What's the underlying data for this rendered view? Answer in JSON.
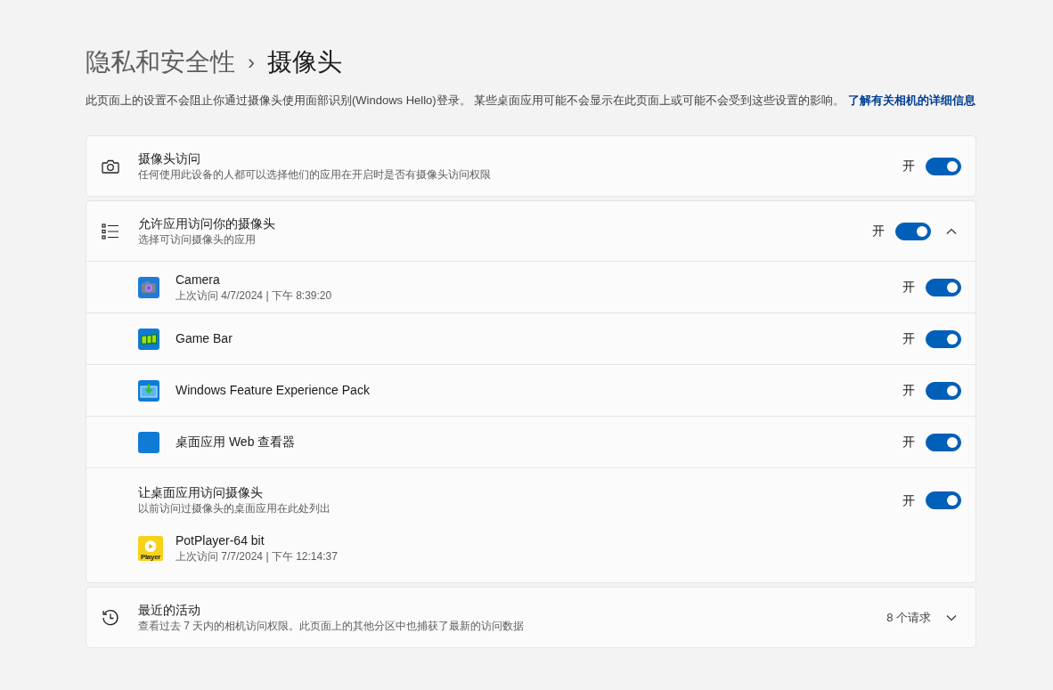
{
  "breadcrumb": {
    "parent": "隐私和安全性",
    "separator": "›",
    "current": "摄像头"
  },
  "description": {
    "text": "此页面上的设置不会阻止你通过摄像头使用面部识别(Windows Hello)登录。 某些桌面应用可能不会显示在此页面上或可能不会受到这些设置的影响。",
    "link": "了解有关相机的详细信息"
  },
  "camera_access": {
    "title": "摄像头访问",
    "subtitle": "任何使用此设备的人都可以选择他们的应用在开启时是否有摄像头访问权限",
    "state_label": "开",
    "on": true
  },
  "app_access": {
    "title": "允许应用访问你的摄像头",
    "subtitle": "选择可访问摄像头的应用",
    "state_label": "开",
    "on": true,
    "expanded": true,
    "apps": [
      {
        "kind": "camera",
        "name": "Camera",
        "last_access": "上次访问 4/7/2024  |  下午 8:39:20",
        "state_label": "开",
        "on": true
      },
      {
        "kind": "gamebar",
        "name": "Game Bar",
        "state_label": "开",
        "on": true
      },
      {
        "kind": "feature-pack",
        "name": "Windows Feature Experience Pack",
        "state_label": "开",
        "on": true
      },
      {
        "kind": "web-viewer",
        "name": "桌面应用 Web 查看器",
        "state_label": "开",
        "on": true
      }
    ],
    "desktop": {
      "title": "让桌面应用访问摄像头",
      "subtitle": "以前访问过摄像头的桌面应用在此处列出",
      "state_label": "开",
      "on": true,
      "apps": [
        {
          "kind": "potplayer",
          "name": "PotPlayer-64 bit",
          "last_access": "上次访问 7/7/2024  |  下午 12:14:37",
          "logo_text": "Player"
        }
      ]
    }
  },
  "recent_activity": {
    "title": "最近的活动",
    "subtitle": "查看过去 7 天内的相机访问权限。此页面上的其他分区中也捕获了最新的访问数据",
    "count": "8 个请求",
    "expanded": false
  }
}
